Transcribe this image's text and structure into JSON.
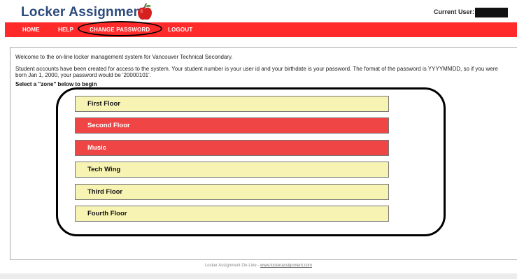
{
  "header": {
    "title": "Locker Assignment",
    "logo_icon": "apple-icon",
    "current_user_label": "Current User:"
  },
  "nav": {
    "items": [
      {
        "label": "HOME"
      },
      {
        "label": "HELP"
      },
      {
        "label": "CHANGE PASSWORD"
      },
      {
        "label": "LOGOUT"
      }
    ],
    "background": "#ff2a2a"
  },
  "content": {
    "welcome": "Welcome to the on-line locker management system for Vancouver Technical Secondary.",
    "accounts": "Student accounts have been created for access to the system. Your student number is your user id and your birthdate is your password. The format of the password is YYYYMMDD, so if you were born Jan 1, 2000, your password would be '20000101'.",
    "select_prompt": "Select a \"zone\" below to begin"
  },
  "zones": [
    {
      "label": "First Floor",
      "color": "#f7f4b3"
    },
    {
      "label": "Second Floor",
      "color": "#f04545"
    },
    {
      "label": "Music",
      "color": "#f04545"
    },
    {
      "label": "Tech Wing",
      "color": "#f7f4b3"
    },
    {
      "label": "Third Floor",
      "color": "#f7f4b3"
    },
    {
      "label": "Fourth Floor",
      "color": "#f7f4b3"
    }
  ],
  "footer": {
    "text": "Locker Assignment On-Line - ",
    "link": "www.lockerassignment.com"
  }
}
